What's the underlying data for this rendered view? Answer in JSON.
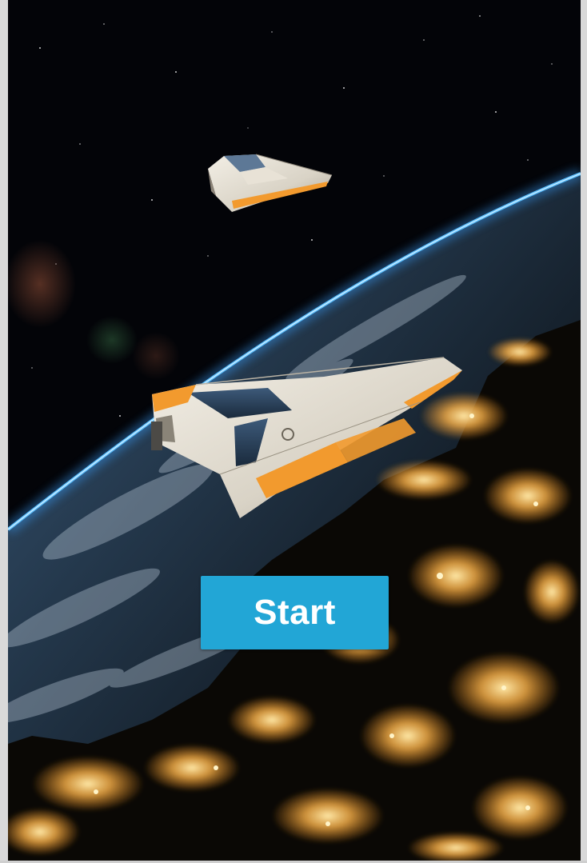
{
  "menu": {
    "start_label": "Start"
  },
  "colors": {
    "button_background": "#22a6d6",
    "button_text": "#ffffff",
    "atmosphere_glow": "#3aa0ff",
    "city_lights": "#ffb54a"
  },
  "scene": {
    "background": "earth-from-orbit-night",
    "objects": [
      "spaceship-small",
      "spaceship-large",
      "planet-earth",
      "lens-flare"
    ]
  }
}
